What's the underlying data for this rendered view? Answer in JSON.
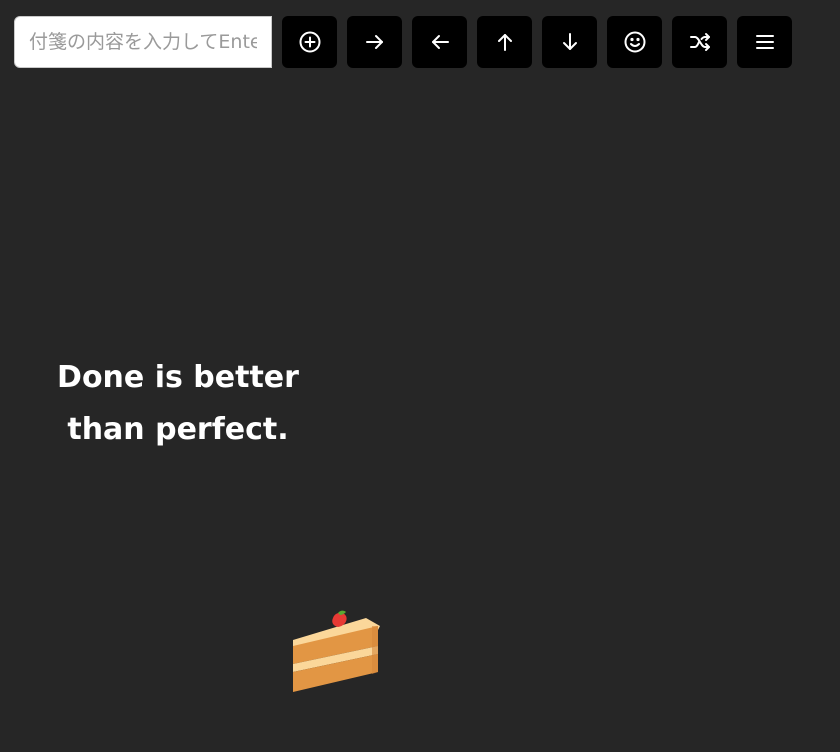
{
  "toolbar": {
    "input": {
      "placeholder": "付箋の内容を入力してEnter",
      "value": ""
    },
    "buttons": [
      {
        "name": "add-note-button",
        "icon": "plus-circle-icon"
      },
      {
        "name": "move-right-button",
        "icon": "arrow-right-icon"
      },
      {
        "name": "move-left-button",
        "icon": "arrow-left-icon"
      },
      {
        "name": "move-up-button",
        "icon": "arrow-up-icon"
      },
      {
        "name": "move-down-button",
        "icon": "arrow-down-icon"
      },
      {
        "name": "emoji-button",
        "icon": "smile-icon"
      },
      {
        "name": "shuffle-button",
        "icon": "shuffle-icon"
      },
      {
        "name": "menu-button",
        "icon": "menu-icon"
      }
    ]
  },
  "board": {
    "notes": [
      {
        "text": "Done is better than perfect."
      }
    ],
    "stickers": [
      {
        "icon": "shortcake-icon"
      }
    ],
    "background_color": "#262626",
    "note_text_color": "#ffffff"
  }
}
